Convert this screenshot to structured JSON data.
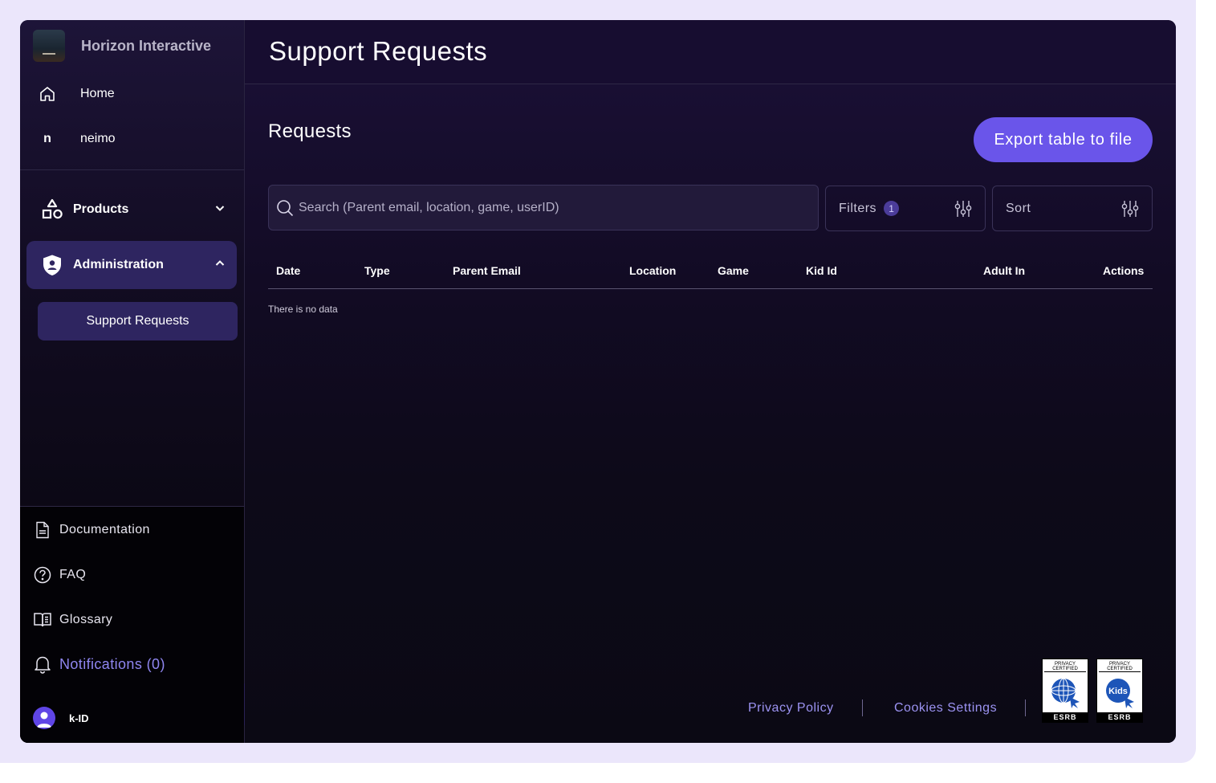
{
  "org": {
    "name": "Horizon Interactive"
  },
  "nav_top": [
    {
      "label": "Home",
      "icon": "home-icon"
    },
    {
      "label": "neimo",
      "initial": "n"
    }
  ],
  "sections": {
    "products": {
      "label": "Products",
      "icon": "shapes-icon",
      "expanded": false
    },
    "administration": {
      "label": "Administration",
      "icon": "shield-icon",
      "expanded": true
    }
  },
  "subnav": {
    "support_requests": "Support Requests"
  },
  "bottom_nav": {
    "documentation": "Documentation",
    "faq": "FAQ",
    "glossary": "Glossary",
    "notifications": "Notifications (0)"
  },
  "user": {
    "name": "k-ID"
  },
  "page": {
    "title": "Support Requests"
  },
  "requests": {
    "title": "Requests",
    "export_label": "Export table to file",
    "search_placeholder": "Search (Parent email, location, game, userID)",
    "filters_label": "Filters",
    "filters_count": "1",
    "sort_label": "Sort",
    "columns": [
      "Date",
      "Type",
      "Parent Email",
      "Location",
      "Game",
      "Kid Id",
      "Adult In",
      "Actions"
    ],
    "empty_text": "There is no data"
  },
  "footer": {
    "privacy": "Privacy Policy",
    "cookies": "Cookies Settings",
    "seals": [
      {
        "caption": "PRIVACY CERTIFIED",
        "bottom": "ESRB",
        "variant": "globe"
      },
      {
        "caption": "PRIVACY CERTIFIED",
        "bottom": "ESRB",
        "variant": "Kids"
      }
    ]
  },
  "colors": {
    "accent": "#6a55ea",
    "active_nav": "#2e2560",
    "link": "#9c93f2",
    "background": "#0f0a1c"
  }
}
